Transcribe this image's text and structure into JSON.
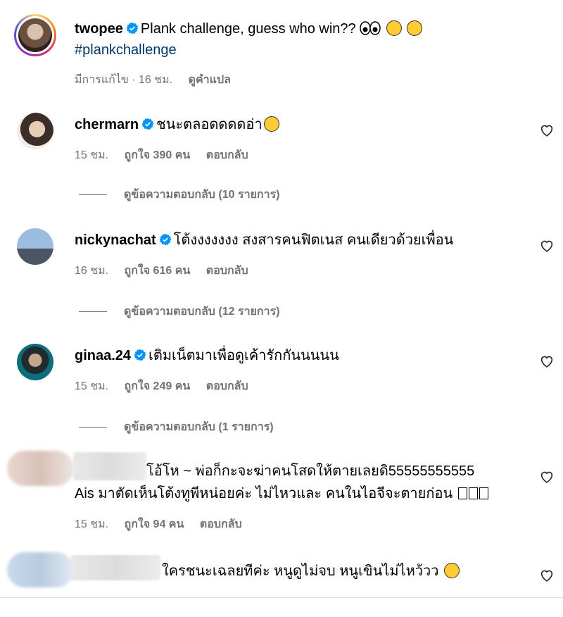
{
  "post": {
    "username": "twopee",
    "caption": "Plank challenge, guess who win??",
    "hashtag": "#plankchallenge",
    "edited": "มีการแก้ไข · 16 ชม.",
    "translate": "ดูคำแปล"
  },
  "comments": [
    {
      "username": "chermarn",
      "verified": true,
      "text": "ชนะตลอดดดดอ่า",
      "time": "15 ชม.",
      "likes": "ถูกใจ 390 คน",
      "reply": "ตอบกลับ",
      "view_replies": "ดูข้อความตอบกลับ (10 รายการ)"
    },
    {
      "username": "nickynachat",
      "verified": true,
      "text": "โต้งงงงงงง สงสารคนฟิตเนส คนเดียวด้วยเพื่อน",
      "time": "16 ชม.",
      "likes": "ถูกใจ 616 คน",
      "reply": "ตอบกลับ",
      "view_replies": "ดูข้อความตอบกลับ (12 รายการ)"
    },
    {
      "username": "ginaa.24",
      "verified": true,
      "text": "เติมเน็ตมาเพื่อดูเค้ารักกันนนนน",
      "time": "15 ชม.",
      "likes": "ถูกใจ 249 คน",
      "reply": "ตอบกลับ",
      "view_replies": "ดูข้อความตอบกลับ (1 รายการ)"
    },
    {
      "username": "",
      "verified": false,
      "text": "โอ้โห ~ พ่อก็กะจะฆ่าคนโสดให้ตายเลยดิ55555555555",
      "text2": "Ais มาตัดเห็นโต้งทูพีหน่อยค่ะ ไม่ไหวและ คนในไอจีจะตายก่อน",
      "time": "15 ชม.",
      "likes": "ถูกใจ 94 คน",
      "reply": "ตอบกลับ"
    },
    {
      "username": "",
      "verified": false,
      "text": "ใครชนะเฉลยทีค่ะ หนูดูไม่จบ หนูเขินไม่ไหว้วว"
    }
  ],
  "colors": {
    "verified": "#0095f6",
    "meta": "#737373",
    "hashtag": "#00376b"
  }
}
